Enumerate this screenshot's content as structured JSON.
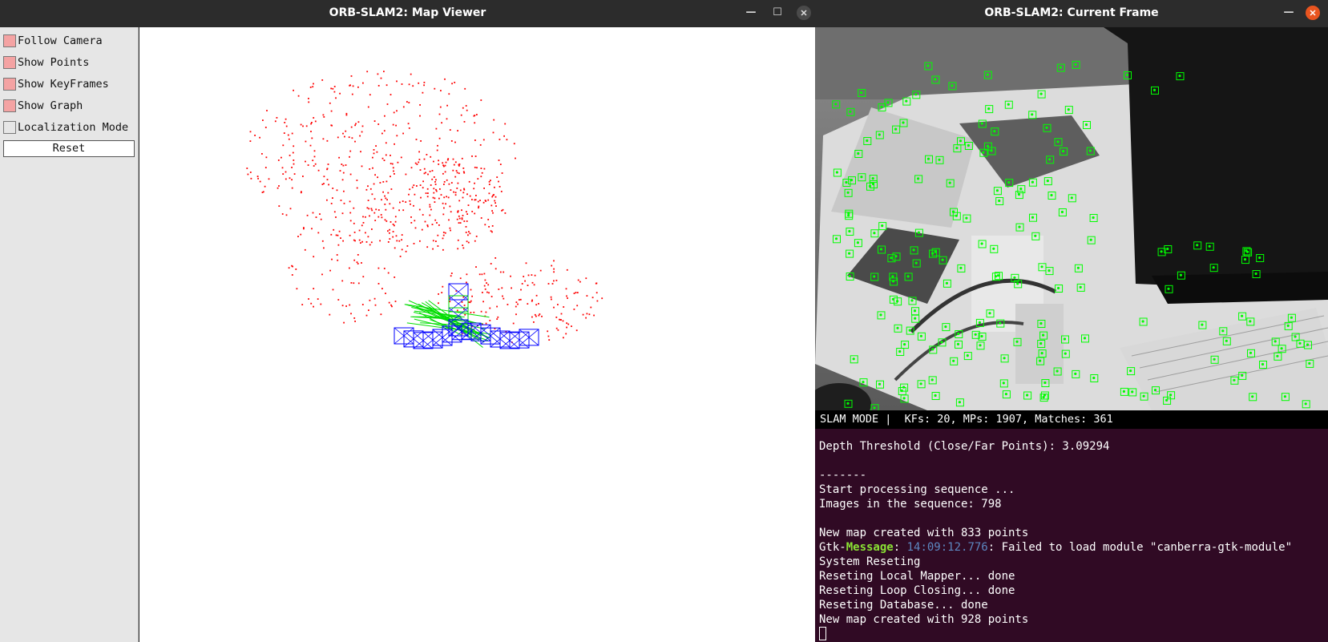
{
  "map_viewer": {
    "title": "ORB-SLAM2: Map Viewer",
    "minimize_glyph": "—",
    "maximize_glyph": "☐",
    "options": [
      {
        "label": "Follow Camera",
        "checked": true
      },
      {
        "label": "Show Points",
        "checked": true
      },
      {
        "label": "Show KeyFrames",
        "checked": true
      },
      {
        "label": "Show Graph",
        "checked": true
      },
      {
        "label": "Localization Mode",
        "checked": false
      }
    ],
    "reset_label": "Reset",
    "colors": {
      "checked": "#f4a3a3",
      "unchecked": "#e6e6e6",
      "map_points": "#ff0000",
      "keyframes": "#0000ff",
      "graph_edges": "#00dd00"
    }
  },
  "current_frame": {
    "title": "ORB-SLAM2: Current Frame",
    "minimize_glyph": "—",
    "status": "SLAM MODE |  KFs: 20, MPs: 1907, Matches: 361",
    "feature_color": "#00ff00"
  },
  "terminal": {
    "background": "#300a24",
    "lines": [
      "Depth Threshold (Close/Far Points): 3.09294",
      "",
      "-------",
      "Start processing sequence ...",
      "Images in the sequence: 798",
      "",
      "New map created with 833 points",
      "System Reseting",
      "Reseting Local Mapper... done",
      "Reseting Loop Closing... done",
      "Reseting Database... done",
      "New map created with 928 points"
    ],
    "gtk_message": {
      "prefix": "Gtk-",
      "keyword": "Message",
      "colon": ": ",
      "timestamp": "14:09:12.776",
      "text": ": Failed to load module \"canberra-gtk-module\""
    }
  }
}
